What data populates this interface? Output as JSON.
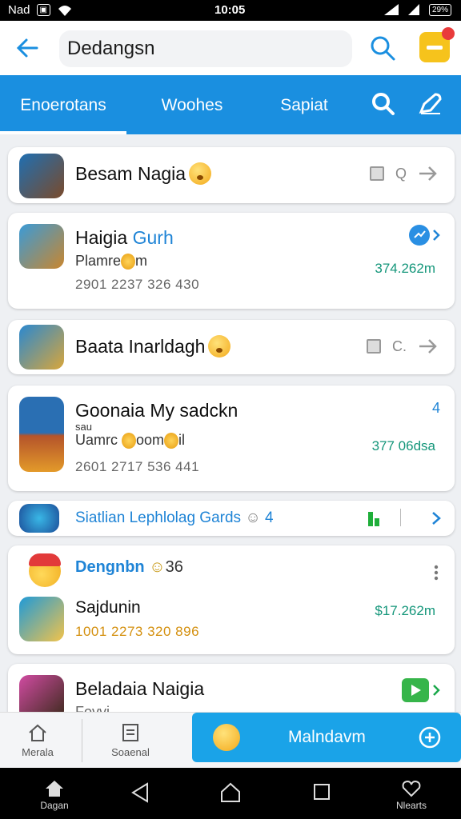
{
  "status_bar": {
    "carrier": "Nad",
    "time": "10:05",
    "battery": "29%"
  },
  "header": {
    "search_value": "Dedangsn"
  },
  "tabs": [
    {
      "label": "Enoerotans",
      "active": true
    },
    {
      "label": "Woohes",
      "active": false
    },
    {
      "label": "Sapiat",
      "active": false
    }
  ],
  "cards": [
    {
      "title": "Besam Nagia"
    },
    {
      "title_main": "Haigia ",
      "title_accent": "Gurh",
      "subtitle": "Plamre",
      "subtitle_end": "m",
      "meta": "2901 2237 326 430",
      "amount": "374.262m"
    },
    {
      "title": "Baata Inarldagh"
    },
    {
      "title": "Goonaia My sadckn",
      "tag": "sau",
      "subtitle": "Uamrc",
      "subtitle_mid": "oom",
      "subtitle_end": "il",
      "meta": "2601 2717 536 441",
      "amount": "377 06dsa",
      "badge": "4"
    },
    {
      "title": "Siatlian Lephlolag Gards",
      "count": "4"
    },
    {
      "header_title": "Dengnbn",
      "header_count": "36",
      "subtitle": "Sajdunin",
      "meta": "1001 2273 320 896",
      "amount": "$17.262m"
    },
    {
      "title": "Beladaia Naigia",
      "subtitle": "Fovvi"
    }
  ],
  "bottom_nav": {
    "items": [
      {
        "label": "Merala"
      },
      {
        "label": "Soaenal"
      }
    ],
    "cta_label": "Malndavm"
  },
  "system_nav": {
    "left_label": "Dagan",
    "right_label": "Nlearts"
  },
  "colors": {
    "primary": "#1a8fe0",
    "accent": "#1f84d6",
    "amount": "#14967a",
    "meta_orange": "#d4900f"
  }
}
